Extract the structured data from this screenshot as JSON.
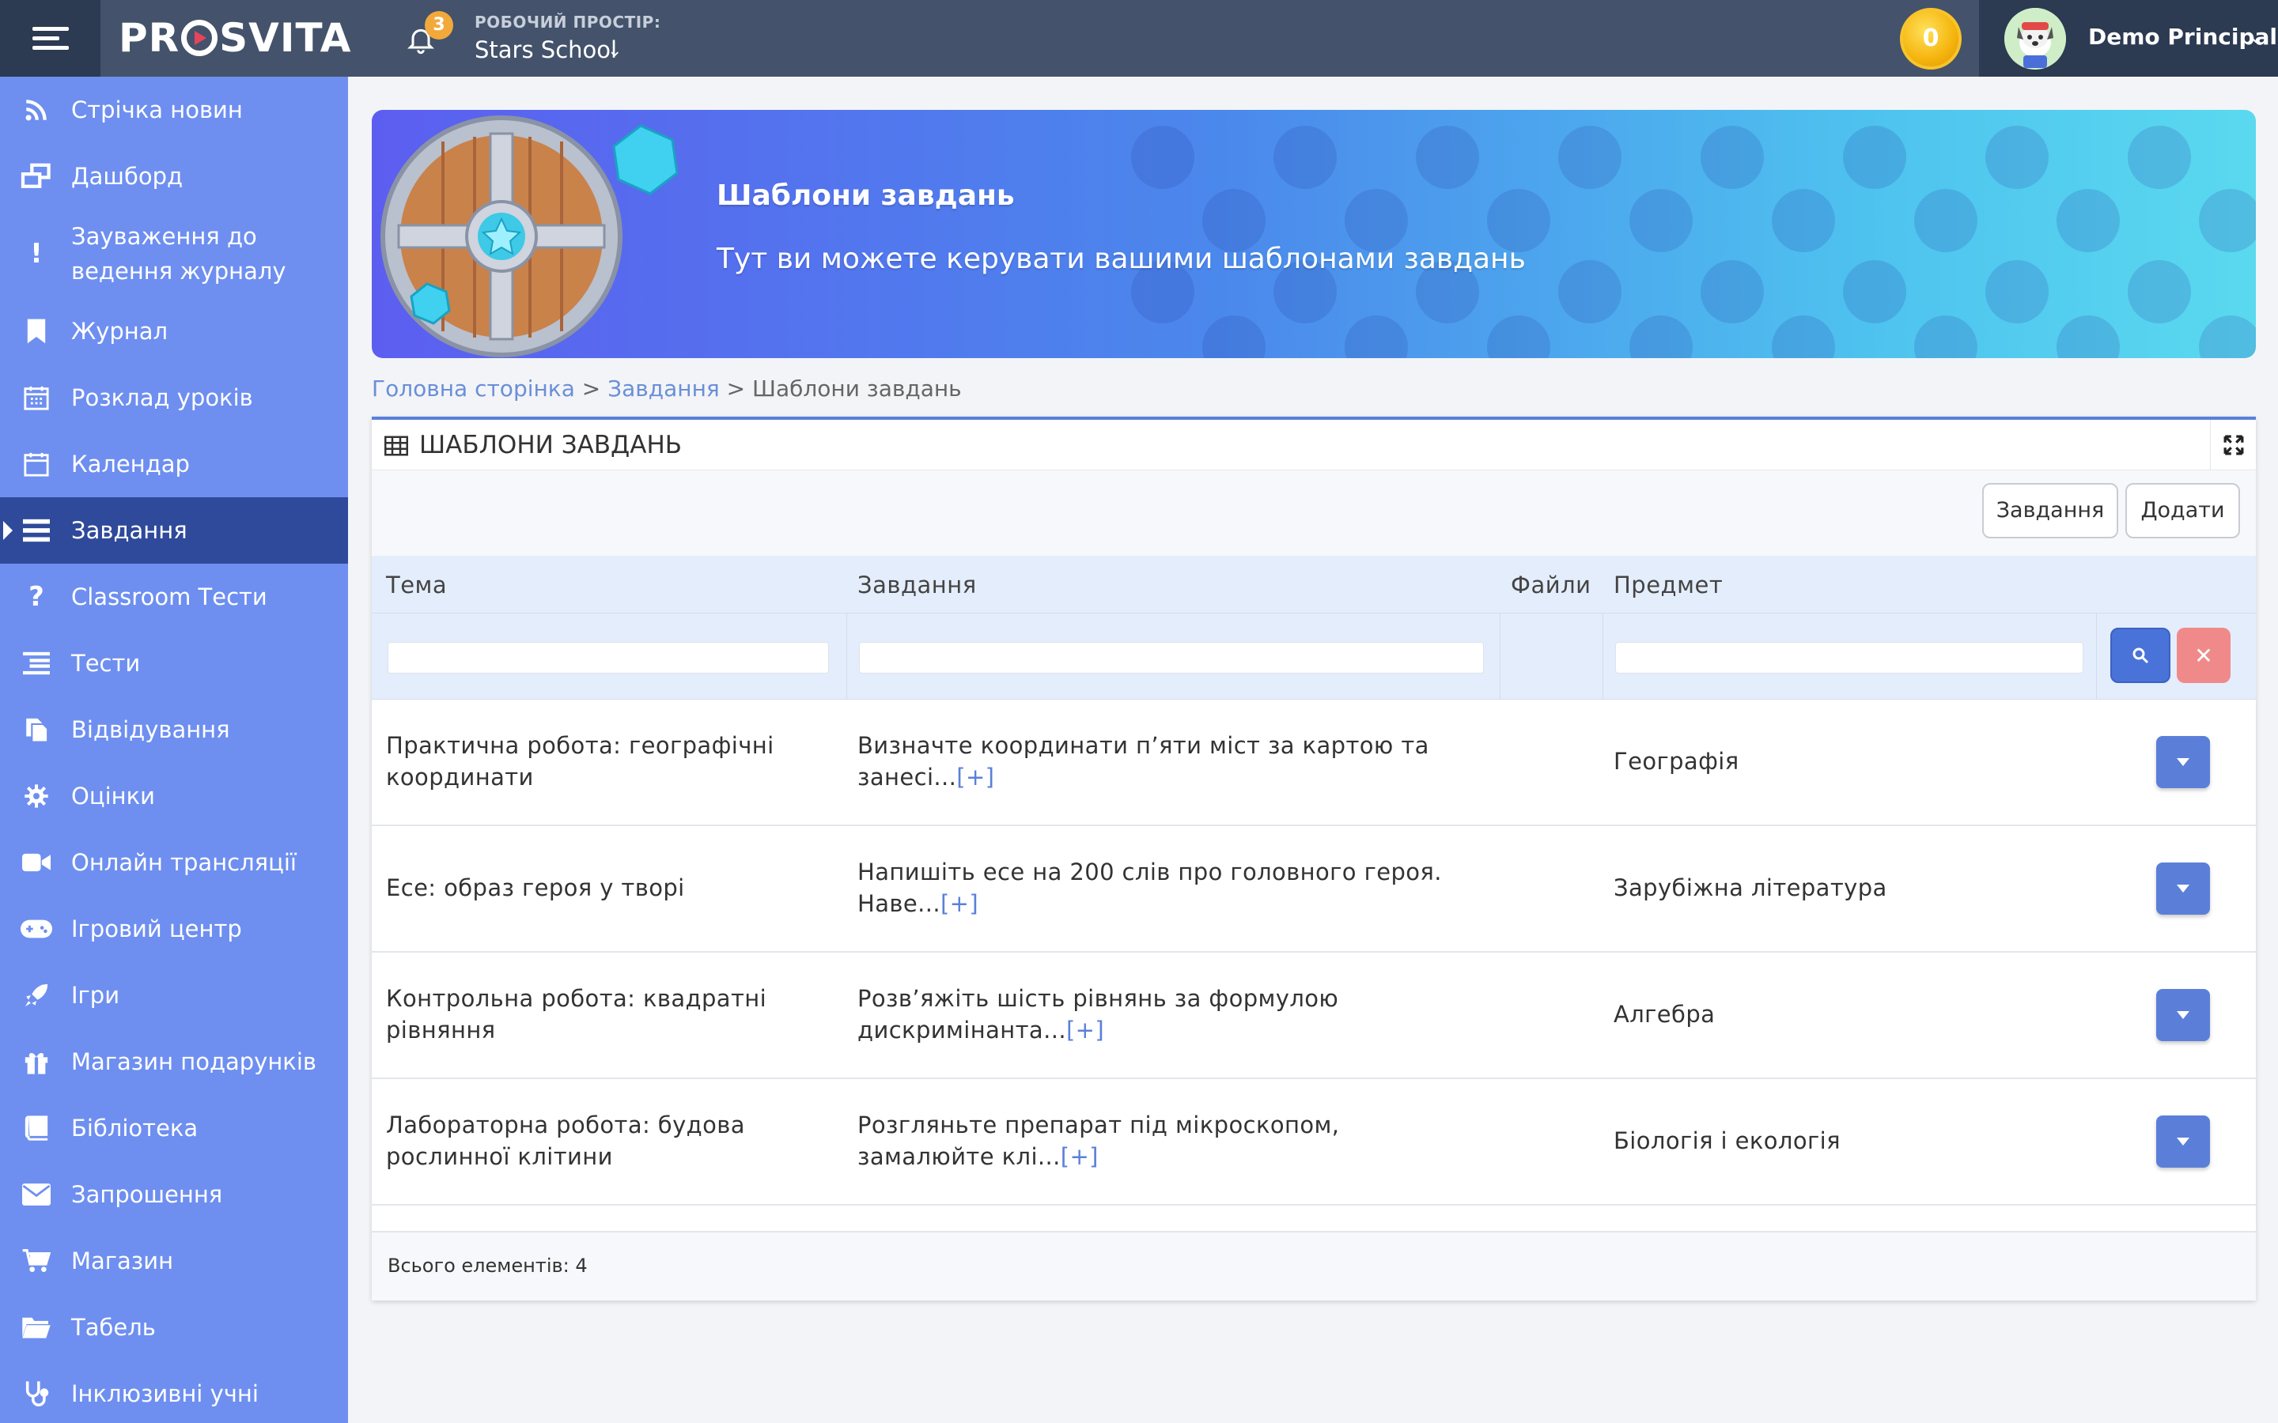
{
  "topbar": {
    "logo": "PROSVITA",
    "notification_count": "3",
    "workspace_label": "РОБОЧИЙ ПРОСТІР:",
    "workspace_name": "Stars School",
    "coins": "0",
    "user_name": "Demo Principal"
  },
  "sidebar": {
    "items": [
      {
        "label": "Стрічка новин",
        "icon": "rss-icon"
      },
      {
        "label": "Дашборд",
        "icon": "windows-icon"
      },
      {
        "label": "Зауваження до ведення журналу",
        "icon": "exclamation-icon"
      },
      {
        "label": "Журнал",
        "icon": "bookmark-icon"
      },
      {
        "label": "Розклад уроків",
        "icon": "calendar-grid-icon"
      },
      {
        "label": "Календар",
        "icon": "calendar-icon"
      },
      {
        "label": "Завдання",
        "icon": "tasks-icon"
      },
      {
        "label": "Classroom Тести",
        "icon": "question-icon"
      },
      {
        "label": "Тести",
        "icon": "list-icon"
      },
      {
        "label": "Відвідування",
        "icon": "copy-icon"
      },
      {
        "label": "Оцінки",
        "icon": "gear-icon"
      },
      {
        "label": "Онлайн трансляції",
        "icon": "video-icon"
      },
      {
        "label": "Ігровий центр",
        "icon": "gamepad-icon"
      },
      {
        "label": "Ігри",
        "icon": "rocket-icon"
      },
      {
        "label": "Магазин подарунків",
        "icon": "gift-icon"
      },
      {
        "label": "Бібліотека",
        "icon": "book-icon"
      },
      {
        "label": "Запрошення",
        "icon": "envelope-icon"
      },
      {
        "label": "Магазин",
        "icon": "cart-icon"
      },
      {
        "label": "Табель",
        "icon": "folder-icon"
      },
      {
        "label": "Інклюзивні учні",
        "icon": "stethoscope-icon"
      }
    ],
    "active_index": 6
  },
  "banner": {
    "title": "Шаблони завдань",
    "subtitle": "Тут ви можете керувати вашими шаблонами завдань"
  },
  "breadcrumb": {
    "home": "Головна сторінка",
    "sep1": " > ",
    "tasks": "Завдання",
    "sep2": " > ",
    "current": "Шаблони завдань"
  },
  "panel": {
    "title": "ШАБЛОНИ ЗАВДАНЬ",
    "btn_tasks": "Завдання",
    "btn_add": "Додати",
    "columns": [
      "Тема",
      "Завдання",
      "Файли",
      "Предмет"
    ],
    "rows": [
      {
        "topic": "Практична робота: географічні координати",
        "task": "Визначте координати п’яти міст за картою та занесі...",
        "more": "[+]",
        "subject": "Географія"
      },
      {
        "topic": "Есе: образ героя у творі",
        "task": "Напишіть есе на 200 слів про головного героя. Наве...",
        "more": "[+]",
        "subject": "Зарубіжна література"
      },
      {
        "topic": "Контрольна робота: квадратні рівняння",
        "task": "Розв’яжіть шість рівнянь за формулою дискримінанта...",
        "more": "[+]",
        "subject": "Алгебра"
      },
      {
        "topic": "Лабораторна робота: будова рослинної клітини",
        "task": "Розгляньте препарат під мікроскопом, замалюйте клі...",
        "more": "[+]",
        "subject": "Біологія і екологія"
      }
    ],
    "total": "Всього елементів: 4"
  },
  "colors": {
    "topbar": "#44536b",
    "sidebar": "#6e8ff0",
    "sidebar_active": "#2f4a9a",
    "accent": "#5b7fd9"
  }
}
